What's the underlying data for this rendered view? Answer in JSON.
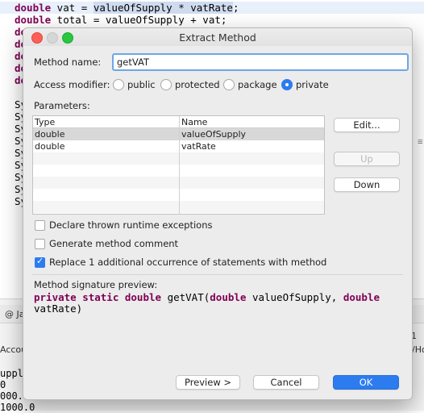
{
  "editor": {
    "line1": {
      "kw": "double",
      "rest1": " vat = ",
      "sel": "valueOfSupply * vatRate",
      "rest2": ";"
    },
    "line2": {
      "kw": "double",
      "rest": " total = valueOfSupply + vat;"
    },
    "gutter_fragments": [
      "do",
      "do",
      "do",
      "do",
      "do"
    ],
    "sy_fragments": [
      "Sy",
      "Sy",
      "Sy",
      "Sy",
      "Sy",
      "Sy",
      "Sy",
      "Sy",
      "Sy"
    ]
  },
  "bottom": {
    "tab_fragment": "@  Ja",
    "account_fragment": "Accou",
    "right_fragment_1": "1",
    "right_fragment_2": "/Ho",
    "console_lines": [
      "upply",
      " 0",
      "000.0",
      "1000.0"
    ]
  },
  "dialog": {
    "title": "Extract Method",
    "method_name_label": "Method name:",
    "method_name_value": "getVAT",
    "access_modifier_label": "Access modifier:",
    "access_options": [
      "public",
      "protected",
      "package",
      "private"
    ],
    "access_selected": "private",
    "parameters_label": "Parameters:",
    "table": {
      "headers": [
        "Type",
        "Name"
      ],
      "rows": [
        {
          "type": "double",
          "name": "valueOfSupply"
        },
        {
          "type": "double",
          "name": "vatRate"
        }
      ]
    },
    "buttons": {
      "edit": "Edit...",
      "up": "Up",
      "down": "Down"
    },
    "checkboxes": [
      {
        "label": "Declare thrown runtime exceptions",
        "checked": false
      },
      {
        "label": "Generate method comment",
        "checked": false
      },
      {
        "label": "Replace 1 additional occurrence of statements with method",
        "checked": true
      }
    ],
    "signature_label": "Method signature preview:",
    "signature": {
      "kw1": "private static double",
      "text1": " getVAT(",
      "kw2": "double",
      "text2": " valueOfSupply, ",
      "kw3": "double",
      "text3": "vatRate)"
    },
    "footer": {
      "preview": "Preview >",
      "cancel": "Cancel",
      "ok": "OK"
    }
  }
}
